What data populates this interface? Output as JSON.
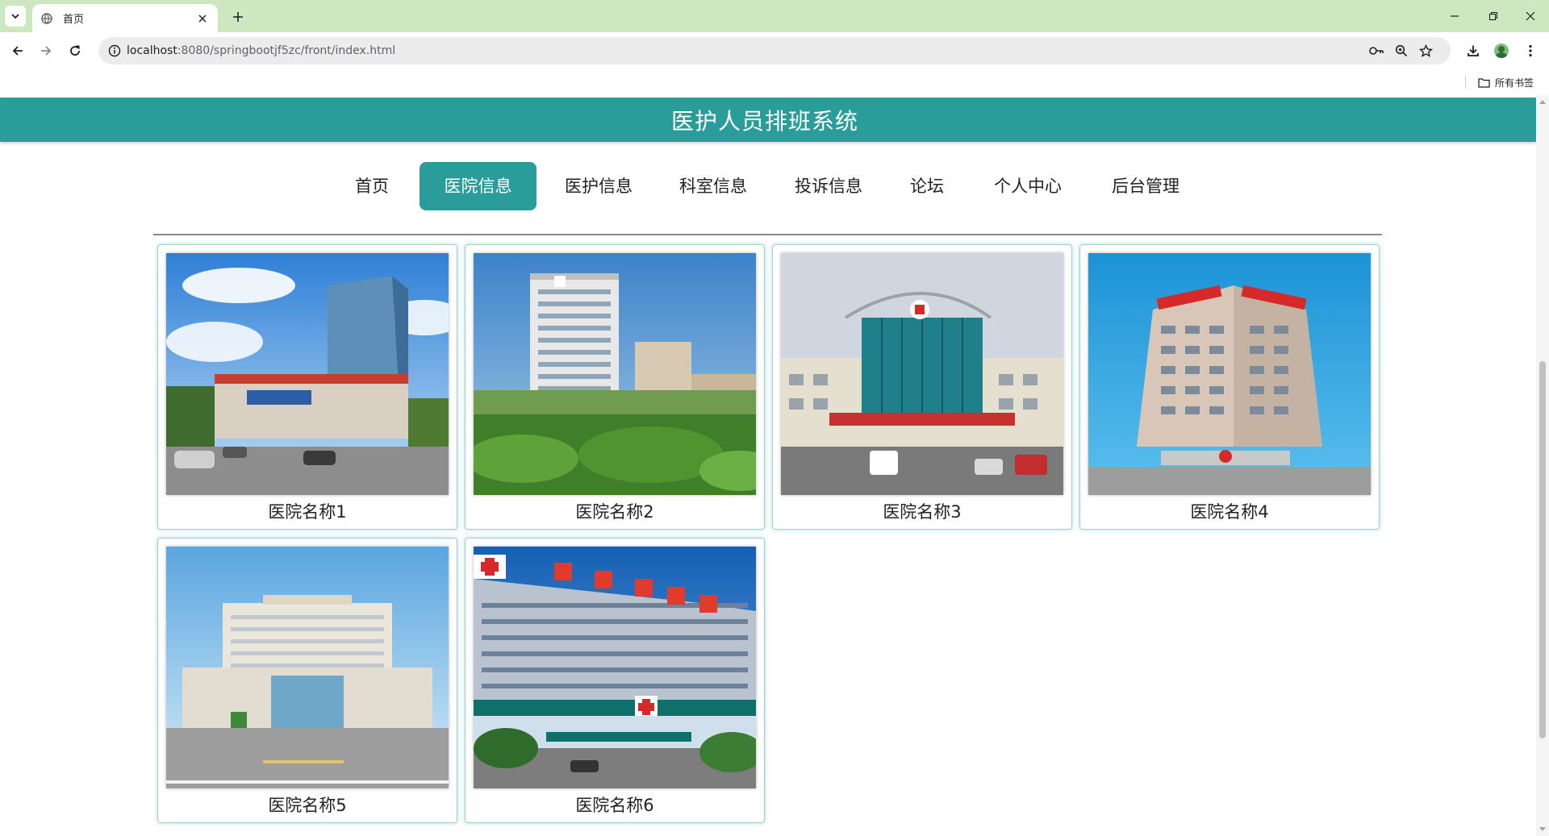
{
  "browser": {
    "tab_title": "首页",
    "url_host": "localhost",
    "url_rest": ":8080/springbootjf5zc/front/index.html",
    "bookmarks_all_label": "所有书签",
    "accent_color": "#cde8c0"
  },
  "site": {
    "title": "医护人员排班系统",
    "brand_color": "#2a9d9a"
  },
  "nav": {
    "items": [
      {
        "label": "首页"
      },
      {
        "label": "医院信息",
        "active": true
      },
      {
        "label": "医护信息"
      },
      {
        "label": "科室信息"
      },
      {
        "label": "投诉信息"
      },
      {
        "label": "论坛"
      },
      {
        "label": "个人中心"
      },
      {
        "label": "后台管理"
      }
    ]
  },
  "hospitals": [
    {
      "name": "医院名称1"
    },
    {
      "name": "医院名称2"
    },
    {
      "name": "医院名称3"
    },
    {
      "name": "医院名称4"
    },
    {
      "name": "医院名称5"
    },
    {
      "name": "医院名称6"
    }
  ]
}
